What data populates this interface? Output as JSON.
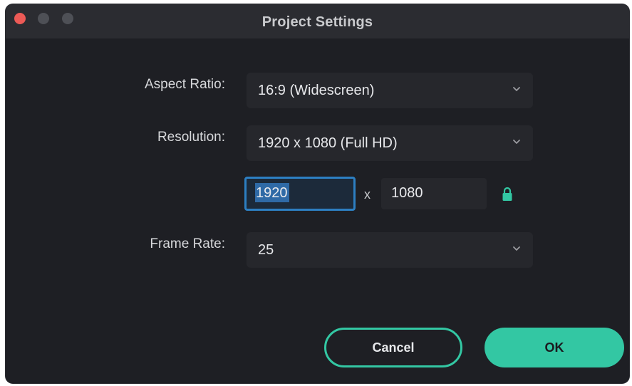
{
  "window": {
    "title": "Project Settings"
  },
  "form": {
    "aspect_ratio": {
      "label": "Aspect Ratio:",
      "value": "16:9 (Widescreen)"
    },
    "resolution": {
      "label": "Resolution:",
      "value": "1920 x 1080 (Full HD)",
      "width": "1920",
      "separator": "x",
      "height": "1080"
    },
    "frame_rate": {
      "label": "Frame Rate:",
      "value": "25"
    }
  },
  "buttons": {
    "cancel_label": "Cancel",
    "ok_label": "OK"
  },
  "icons": {
    "close": "close-button",
    "minimize": "minimize-button",
    "maximize": "maximize-button",
    "dropdown": "chevron-down-icon",
    "aspect_lock": "lock-icon"
  },
  "colors": {
    "accent": "#33c7a3",
    "focus": "#2d7fc2",
    "background": "#1e1f24"
  }
}
